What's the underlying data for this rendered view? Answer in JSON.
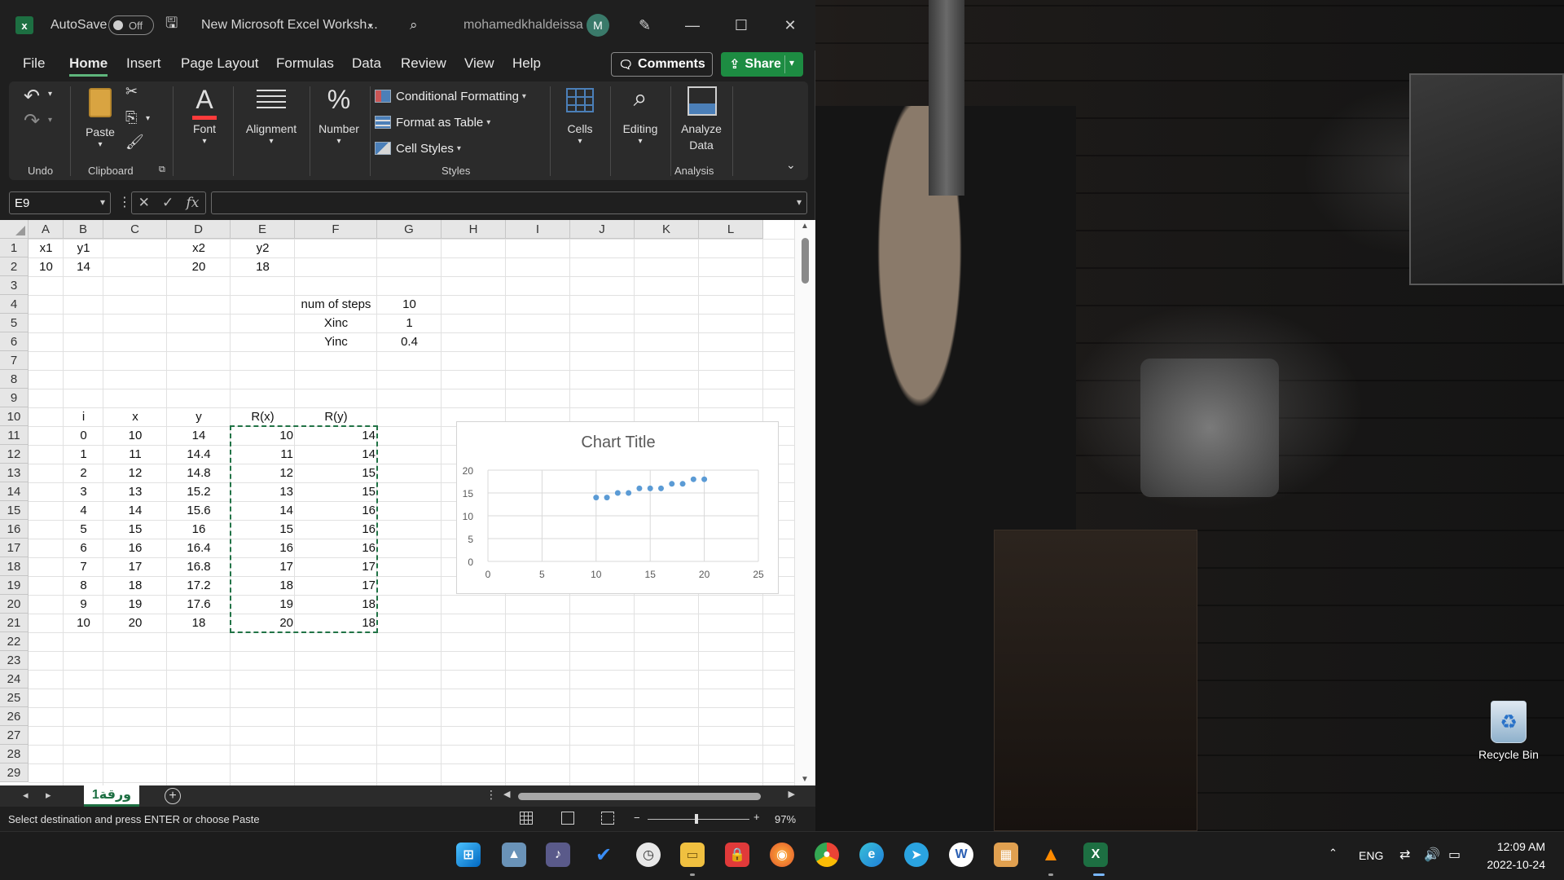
{
  "titlebar": {
    "autosave_label": "AutoSave",
    "autosave_state": "Off",
    "file_name": "New Microsoft Excel Worksh...",
    "user_name": "mohamedkhaldeissa",
    "avatar_initial": "M"
  },
  "ribbon_tabs": [
    "File",
    "Home",
    "Insert",
    "Page Layout",
    "Formulas",
    "Data",
    "Review",
    "View",
    "Help"
  ],
  "actions": {
    "comments": "Comments",
    "share": "Share"
  },
  "ribbon": {
    "paste": "Paste",
    "font": "Font",
    "alignment": "Alignment",
    "number": "Number",
    "conditional_formatting": "Conditional Formatting",
    "format_as_table": "Format as Table",
    "cell_styles": "Cell Styles",
    "cells": "Cells",
    "editing": "Editing",
    "analyze_data_1": "Analyze",
    "analyze_data_2": "Data",
    "groups": {
      "undo": "Undo",
      "clipboard": "Clipboard",
      "styles": "Styles",
      "analysis": "Analysis"
    }
  },
  "formula_bar": {
    "name_box": "E9",
    "fx": "fx",
    "value": ""
  },
  "columns": [
    "A",
    "B",
    "C",
    "D",
    "E",
    "F",
    "G",
    "H",
    "I",
    "J",
    "K",
    "L"
  ],
  "rows": [
    "1",
    "2",
    "3",
    "4",
    "5",
    "6",
    "7",
    "8",
    "9",
    "10",
    "11",
    "12",
    "13",
    "14",
    "15",
    "16",
    "17",
    "18",
    "19",
    "20",
    "21",
    "22",
    "23",
    "24",
    "25",
    "26",
    "27",
    "28",
    "29"
  ],
  "cells": {
    "A1": "x1",
    "B1": "y1",
    "D1": "x2",
    "E1": "y2",
    "A2": "10",
    "B2": "14",
    "D2": "20",
    "E2": "18",
    "F4": "num of steps",
    "G4": "10",
    "F5": "Xinc",
    "G5": "1",
    "F6": "Yinc",
    "G6": "0.4",
    "B10": "i",
    "C10": "x",
    "D10": "y",
    "E10": "R(x)",
    "F10": "R(y)",
    "table": [
      [
        "0",
        "10",
        "14",
        "10",
        "14"
      ],
      [
        "1",
        "11",
        "14.4",
        "11",
        "14"
      ],
      [
        "2",
        "12",
        "14.8",
        "12",
        "15"
      ],
      [
        "3",
        "13",
        "15.2",
        "13",
        "15"
      ],
      [
        "4",
        "14",
        "15.6",
        "14",
        "16"
      ],
      [
        "5",
        "15",
        "16",
        "15",
        "16"
      ],
      [
        "6",
        "16",
        "16.4",
        "16",
        "16"
      ],
      [
        "7",
        "17",
        "16.8",
        "17",
        "17"
      ],
      [
        "8",
        "18",
        "17.2",
        "18",
        "17"
      ],
      [
        "9",
        "19",
        "17.6",
        "19",
        "18"
      ],
      [
        "10",
        "20",
        "18",
        "20",
        "18"
      ]
    ]
  },
  "chart_data": {
    "type": "scatter",
    "title": "Chart Title",
    "xlabel": "",
    "ylabel": "",
    "xlim": [
      0,
      25
    ],
    "ylim": [
      0,
      20
    ],
    "xticks": [
      "0",
      "5",
      "10",
      "15",
      "20",
      "25"
    ],
    "yticks": [
      "0",
      "5",
      "10",
      "15",
      "20"
    ],
    "grid": true,
    "series": [
      {
        "color": "#5b9bd5",
        "x": [
          10,
          11,
          12,
          13,
          14,
          15,
          16,
          17,
          18,
          19,
          20
        ],
        "y": [
          14,
          14,
          15,
          15,
          16,
          16,
          16,
          17,
          17,
          18,
          18
        ]
      }
    ]
  },
  "sheet_tab": "ورقة1",
  "status": {
    "message": "Select destination and press ENTER or choose Paste",
    "zoom": "97%",
    "zoom_minus": "−",
    "zoom_plus": "+"
  },
  "desktop": {
    "recycle_bin": "Recycle Bin"
  },
  "taskbar": {
    "language": "ENG",
    "time": "12:09 AM",
    "date": "2022-10-24",
    "apps": [
      "start",
      "photos",
      "app-b",
      "todo",
      "clock",
      "file-explorer",
      "security",
      "firefox",
      "chrome",
      "edge",
      "telegram",
      "word",
      "photo-app",
      "vlc",
      "excel"
    ]
  }
}
